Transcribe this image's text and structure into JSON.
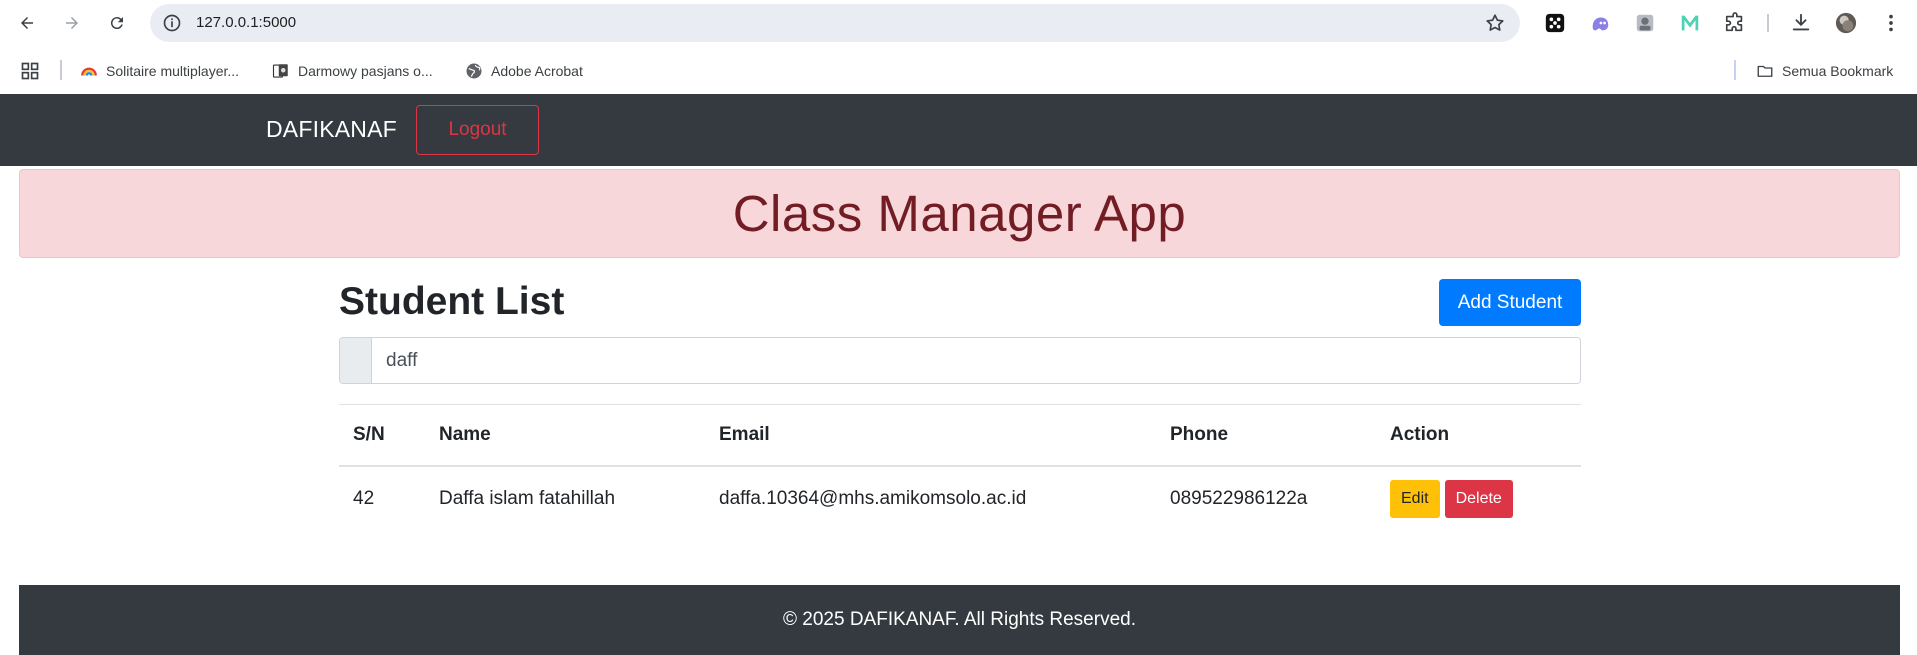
{
  "browser": {
    "url": "127.0.0.1:5000",
    "bookmarks": [
      {
        "label": "Solitaire multiplayer...",
        "icon": "solitaire-rainbow-icon"
      },
      {
        "label": "Darmowy pasjans o...",
        "icon": "cards-favicon-icon"
      },
      {
        "label": "Adobe Acrobat",
        "icon": "globe-icon"
      }
    ],
    "all_bookmarks_label": "Semua Bookmark"
  },
  "navbar": {
    "brand": "DAFIKANAF",
    "logout_label": "Logout"
  },
  "alert": {
    "title": "Class Manager App"
  },
  "main": {
    "title": "Student List",
    "add_button_label": "Add Student",
    "search_value": "daff",
    "table": {
      "headers": [
        "S/N",
        "Name",
        "Email",
        "Phone",
        "Action"
      ],
      "rows": [
        {
          "sn": "42",
          "name": "Daffa islam fatahillah",
          "email": "daffa.10364@mhs.amikomsolo.ac.id",
          "phone": "089522986122a",
          "edit_label": "Edit",
          "delete_label": "Delete"
        }
      ]
    }
  },
  "footer": {
    "text": "© 2025 DAFIKANAF. All Rights Reserved."
  },
  "colors": {
    "navbar_bg": "#343a40",
    "alert_bg": "#f8d7da",
    "alert_text": "#721c24",
    "primary": "#007bff",
    "warning": "#ffc107",
    "danger": "#dc3545"
  }
}
